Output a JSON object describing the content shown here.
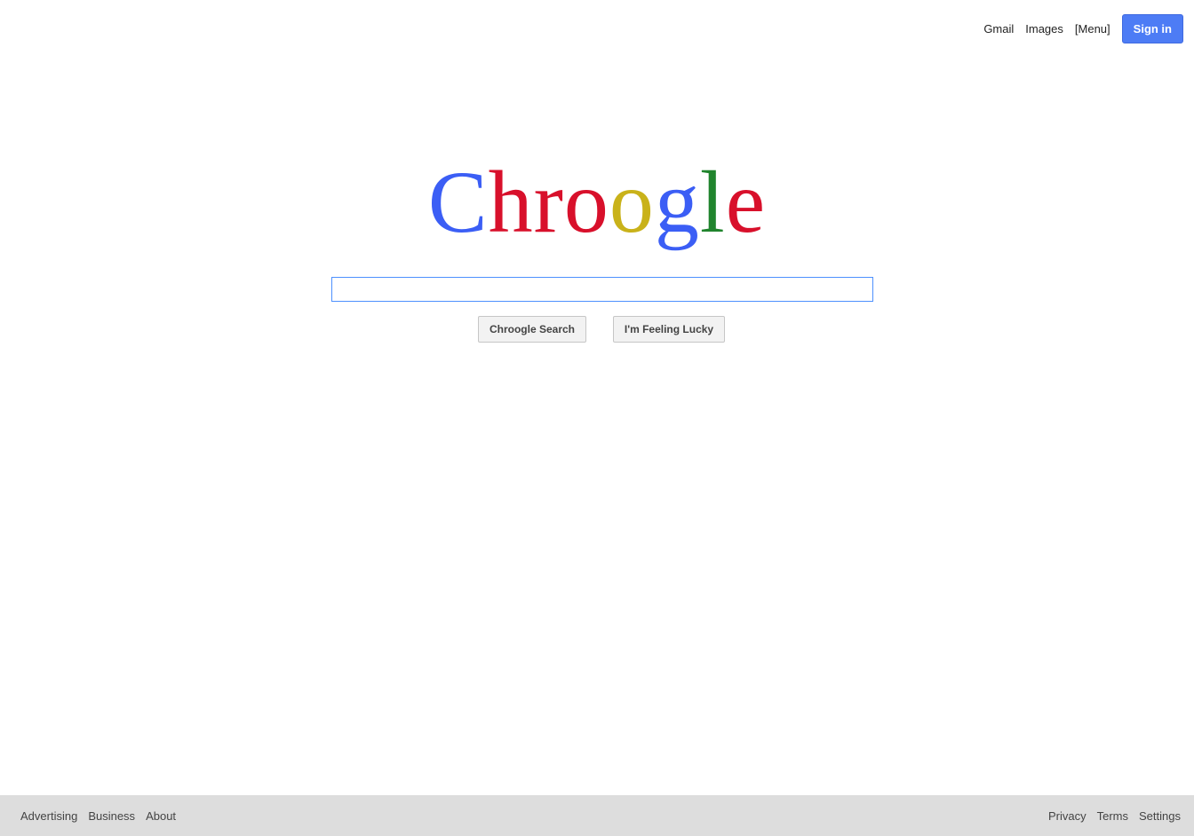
{
  "header": {
    "links": [
      "Gmail",
      "Images",
      "[Menu]"
    ],
    "sign_in": "Sign in"
  },
  "logo": {
    "letters": [
      {
        "char": "C",
        "color": "#3b5ef5"
      },
      {
        "char": "h",
        "color": "#d8102b"
      },
      {
        "char": "r",
        "color": "#d8102b"
      },
      {
        "char": "o",
        "color": "#d8102b"
      },
      {
        "char": "o",
        "color": "#c9b21a"
      },
      {
        "char": "g",
        "color": "#3b5ef5"
      },
      {
        "char": "l",
        "color": "#20842d"
      },
      {
        "char": "e",
        "color": "#d8102b"
      }
    ]
  },
  "search": {
    "value": "",
    "search_button": "Chroogle Search",
    "lucky_button": "I'm Feeling Lucky"
  },
  "footer": {
    "left": [
      "Advertising",
      "Business",
      "About"
    ],
    "right": [
      "Privacy",
      "Terms",
      "Settings"
    ]
  },
  "colors": {
    "accent": "#4d7cf5",
    "footer_bg": "#dddddd",
    "focus_border": "#4d90fe"
  }
}
